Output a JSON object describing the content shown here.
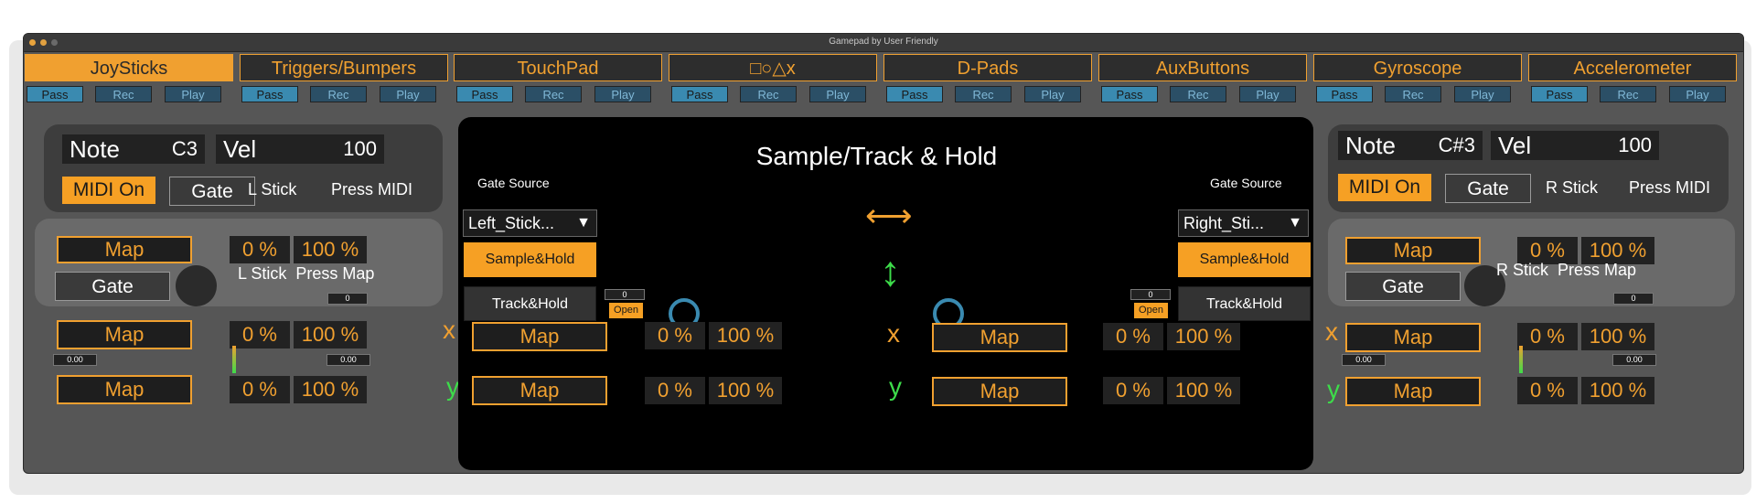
{
  "window": {
    "title": "Gamepad by User Friendly"
  },
  "tabs": [
    {
      "label": "JoySticks",
      "active": true
    },
    {
      "label": "Triggers/Bumpers",
      "active": false
    },
    {
      "label": "TouchPad",
      "active": false
    },
    {
      "label": "□○△x",
      "active": false
    },
    {
      "label": "D-Pads",
      "active": false
    },
    {
      "label": "AuxButtons",
      "active": false
    },
    {
      "label": "Gyroscope",
      "active": false
    },
    {
      "label": "Accelerometer",
      "active": false
    }
  ],
  "mode_buttons": {
    "pass": "Pass",
    "rec": "Rec",
    "play": "Play"
  },
  "left": {
    "note_label": "Note",
    "note_value": "C3",
    "vel_label": "Vel",
    "vel_value": "100",
    "midi_on": "MIDI On",
    "gate": "Gate",
    "stick_label": "L Stick",
    "press_midi": "Press MIDI",
    "map": "Map",
    "min_pct": "0 %",
    "max_pct": "100 %",
    "gate2": "Gate",
    "press_map": "L Stick  Press Map",
    "mini_value": "0",
    "x_map": "Map",
    "x_min": "0 %",
    "x_max": "100 %",
    "x_left_val": "0.00",
    "x_right_val": "0.00",
    "y_map": "Map",
    "y_min": "0 %",
    "y_max": "100 %",
    "x_axis": "x",
    "y_axis": "y"
  },
  "center": {
    "title": "Sample/Track & Hold",
    "left_gate_source": "Gate Source",
    "right_gate_source": "Gate Source",
    "left_select": "Left_Stick...",
    "right_select": "Right_Sti...",
    "sample_hold": "Sample&Hold",
    "track_hold": "Track&Hold",
    "left_num": "0",
    "right_num": "0",
    "open": "Open",
    "lx_map": "Map",
    "lx_min": "0 %",
    "lx_max": "100 %",
    "ly_map": "Map",
    "ly_min": "0 %",
    "ly_max": "100 %",
    "rx_map": "Map",
    "rx_min": "0 %",
    "rx_max": "100 %",
    "ry_map": "Map",
    "ry_min": "0 %",
    "ry_max": "100 %",
    "x_axis": "x",
    "y_axis": "y",
    "h_arrow": "⟷",
    "v_arrow": "↕"
  },
  "right": {
    "note_label": "Note",
    "note_value": "C#3",
    "vel_label": "Vel",
    "vel_value": "100",
    "midi_on": "MIDI On",
    "gate": "Gate",
    "stick_label": "R Stick",
    "press_midi": "Press MIDI",
    "map": "Map",
    "min_pct": "0 %",
    "max_pct": "100 %",
    "gate2": "Gate",
    "press_map": "R Stick  Press Map",
    "mini_value": "0",
    "x_map": "Map",
    "x_min": "0 %",
    "x_max": "100 %",
    "x_left_val": "0.00",
    "x_right_val": "0.00",
    "y_map": "Map",
    "y_min": "0 %",
    "y_max": "100 %",
    "x_axis": "x",
    "y_axis": "y"
  },
  "colors": {
    "accent": "#f0a030",
    "blue": "#3a8ab0",
    "green": "#3ddc4a",
    "panel": "#3d3d3d"
  }
}
